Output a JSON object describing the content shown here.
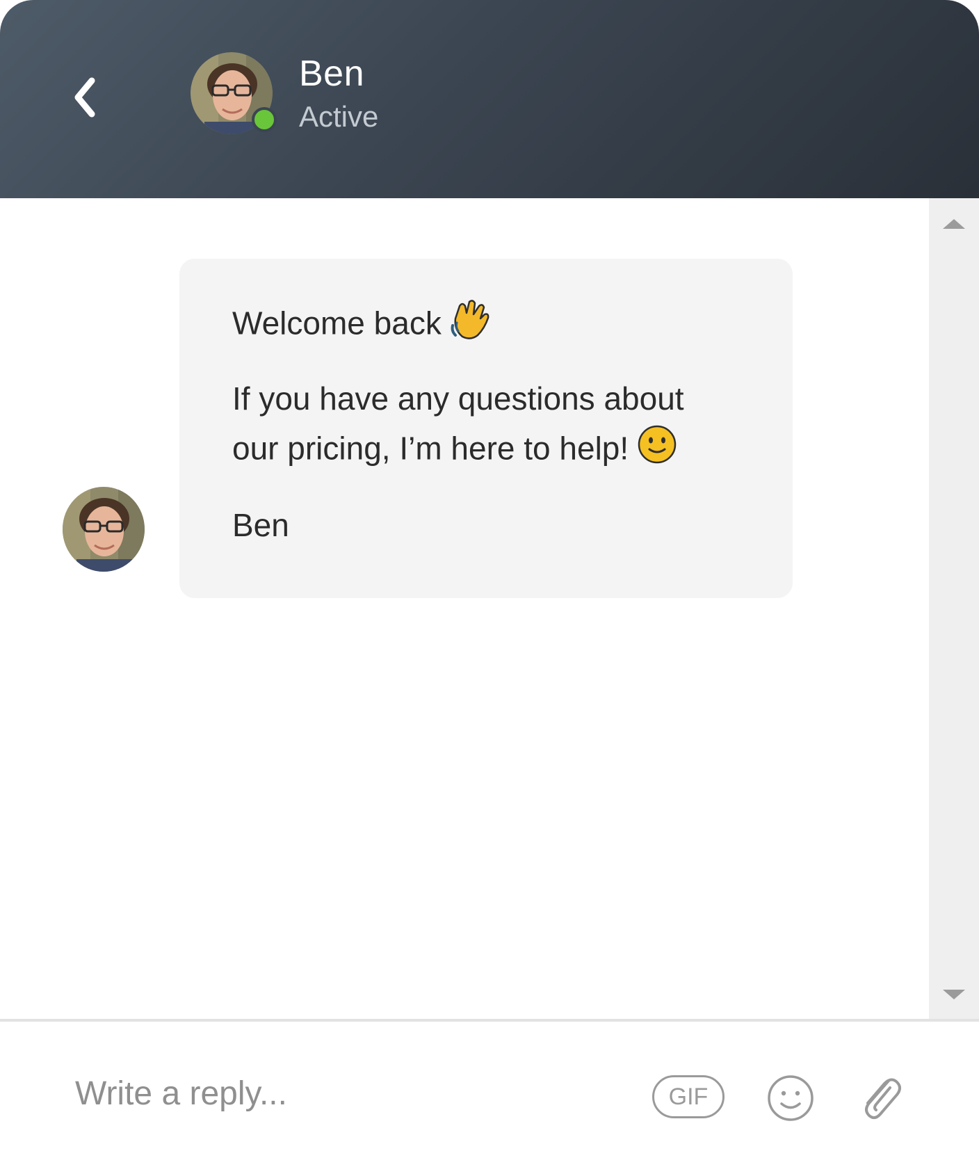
{
  "header": {
    "back_icon": "chevron-left-icon",
    "agent_name": "Ben",
    "agent_status": "Active",
    "status_color": "#69c63a"
  },
  "conversation": {
    "message": {
      "greeting": "Welcome back",
      "greeting_emoji": "waving-hand",
      "body_line1": "If you have any questions about",
      "body_line2": "our pricing, I’m here to help!",
      "body_emoji": "slightly-smiling-face",
      "signature": "Ben"
    }
  },
  "composer": {
    "placeholder": "Write a reply...",
    "gif_label": "GIF",
    "emoji_icon": "smiley-icon",
    "attach_icon": "paperclip-icon"
  },
  "colors": {
    "header_start": "#4e5b68",
    "header_end": "#2a3038",
    "bubble_bg": "#f4f4f4",
    "scrollbar_bg": "#efefef"
  }
}
